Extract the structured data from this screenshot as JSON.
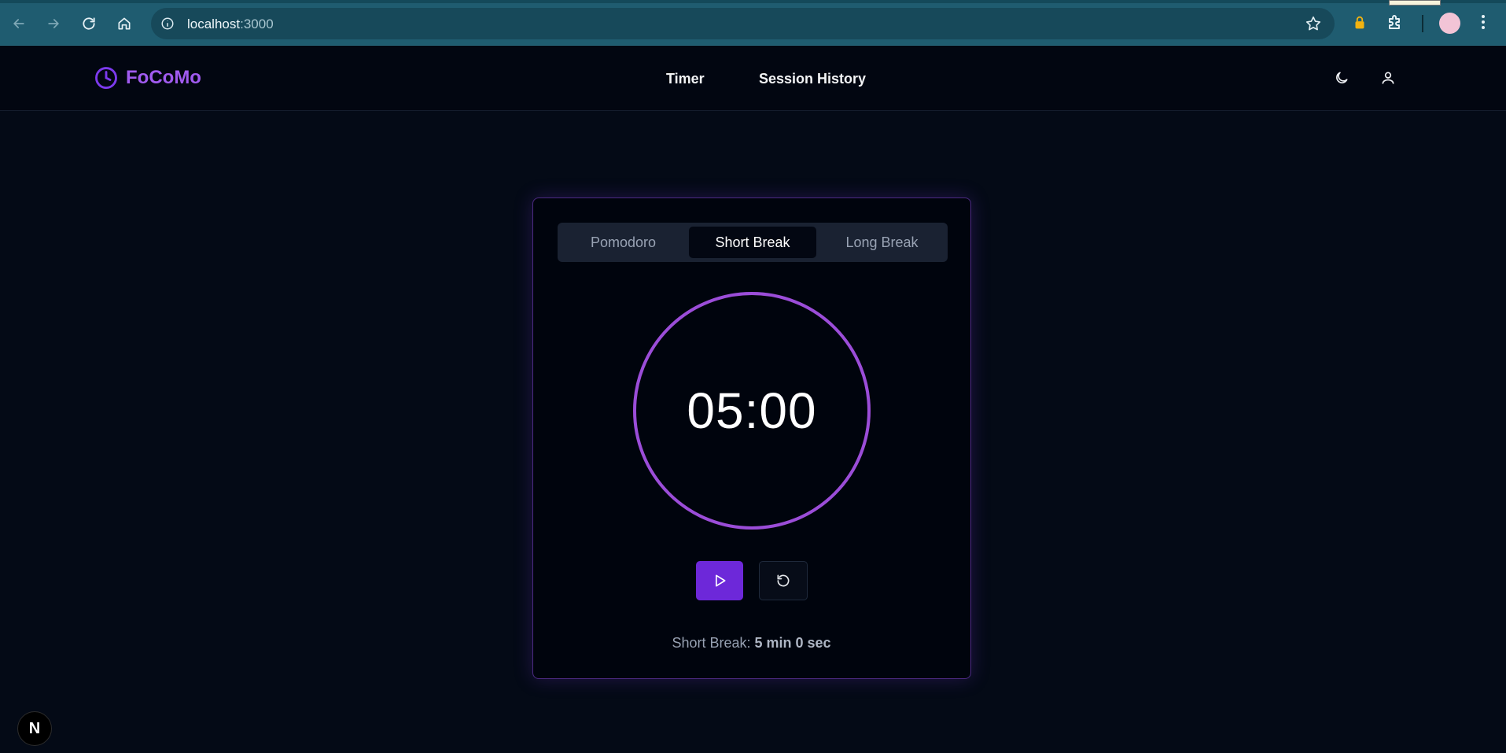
{
  "browser": {
    "url_host": "localhost",
    "url_port": ":3000"
  },
  "header": {
    "logo_text": "FoCoMo",
    "nav": [
      "Timer",
      "Session History"
    ]
  },
  "timer": {
    "tabs": [
      "Pomodoro",
      "Short Break",
      "Long Break"
    ],
    "active_tab": "Short Break",
    "time_display": "05:00",
    "status_label": "Short Break:",
    "status_value": "5 min 0 sec",
    "progress_fraction": 1.0
  },
  "colors": {
    "accent": "#7c3aed",
    "ring": "#9b4dd8",
    "background": "#040a16"
  },
  "icons": {
    "logo": "clock-icon",
    "theme": "moon-icon",
    "user": "user-icon",
    "play": "play-icon",
    "reset": "rotate-ccw-icon"
  },
  "dev_badge": "N"
}
